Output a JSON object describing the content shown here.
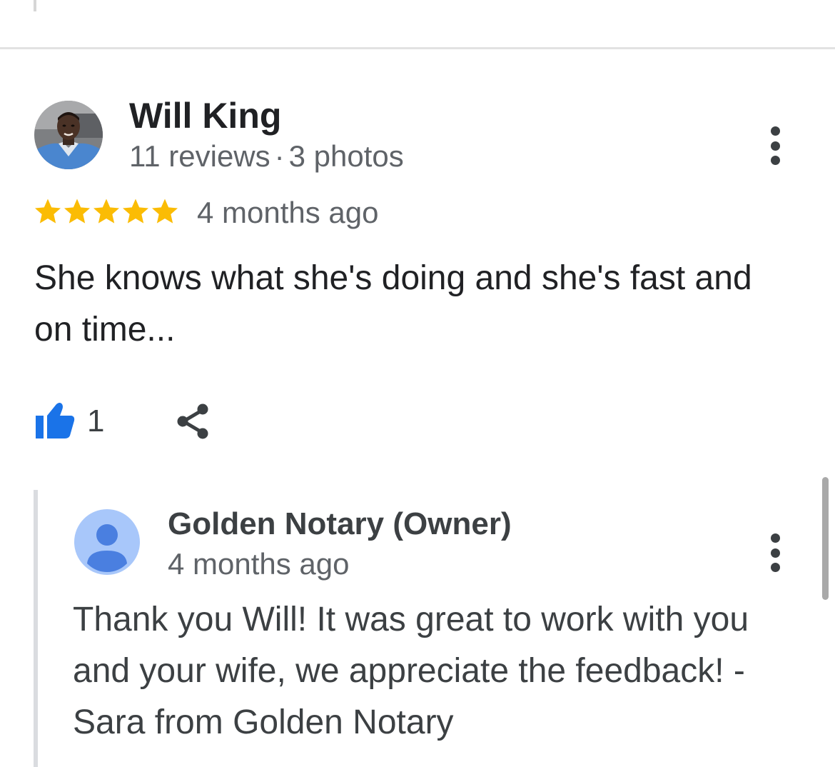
{
  "review": {
    "author_name": "Will King",
    "reviews_count": "11 reviews",
    "separator": "·",
    "photos_count": "3 photos",
    "rating": 5,
    "rating_max": 5,
    "star_color": "#fbbc04",
    "date": "4 months ago",
    "text": "She knows what she's doing and she's fast and on time...",
    "like_count": "1",
    "like_icon": "thumbs-up-icon",
    "like_color": "#1a73e8",
    "share_icon": "share-icon",
    "more_icon": "more-vert-icon"
  },
  "owner_reply": {
    "author_name": "Golden Notary (Owner)",
    "date": "4 months ago",
    "text": "Thank you Will! It was great to work with you and your wife, we appreciate the feedback! - Sara from Golden Notary",
    "avatar_icon": "default-profile-icon",
    "more_icon": "more-vert-icon"
  }
}
